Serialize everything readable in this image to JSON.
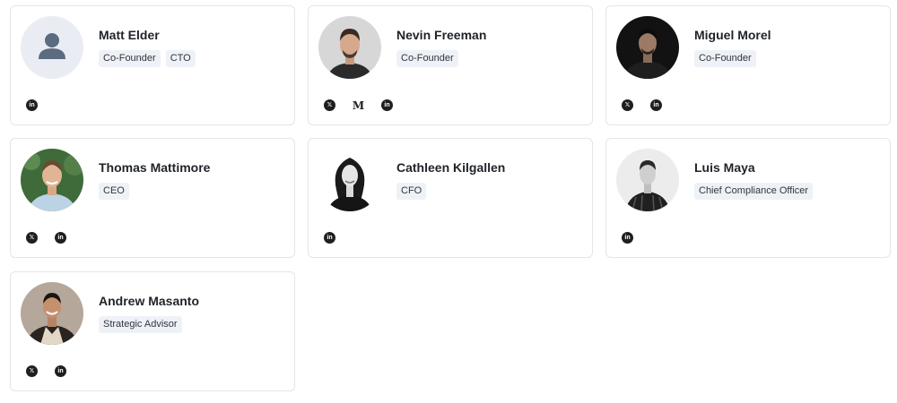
{
  "team": [
    {
      "name": "Matt Elder",
      "tags": [
        "Co-Founder",
        "CTO"
      ],
      "avatar": "placeholder-person-icon",
      "socials": [
        {
          "icon": "linkedin-icon",
          "glyph": "in"
        }
      ]
    },
    {
      "name": "Nevin Freeman",
      "tags": [
        "Co-Founder"
      ],
      "avatar": "photo",
      "socials": [
        {
          "icon": "x-icon",
          "glyph": "𝕏"
        },
        {
          "icon": "medium-icon",
          "glyph": "M"
        },
        {
          "icon": "linkedin-icon",
          "glyph": "in"
        }
      ]
    },
    {
      "name": "Miguel Morel",
      "tags": [
        "Co-Founder"
      ],
      "avatar": "photo",
      "socials": [
        {
          "icon": "x-icon",
          "glyph": "𝕏"
        },
        {
          "icon": "linkedin-icon",
          "glyph": "in"
        }
      ]
    },
    {
      "name": "Thomas Mattimore",
      "tags": [
        "CEO"
      ],
      "avatar": "photo",
      "socials": [
        {
          "icon": "x-icon",
          "glyph": "𝕏"
        },
        {
          "icon": "linkedin-icon",
          "glyph": "in"
        }
      ]
    },
    {
      "name": "Cathleen Kilgallen",
      "tags": [
        "CFO"
      ],
      "avatar": "photo",
      "socials": [
        {
          "icon": "linkedin-icon",
          "glyph": "in"
        }
      ]
    },
    {
      "name": "Luis Maya",
      "tags": [
        "Chief Compliance Officer"
      ],
      "avatar": "photo",
      "socials": [
        {
          "icon": "linkedin-icon",
          "glyph": "in"
        }
      ]
    },
    {
      "name": "Andrew Masanto",
      "tags": [
        "Strategic Advisor"
      ],
      "avatar": "photo",
      "socials": [
        {
          "icon": "x-icon",
          "glyph": "𝕏"
        },
        {
          "icon": "linkedin-icon",
          "glyph": "in"
        }
      ]
    }
  ],
  "colors": {
    "card_border": "#e3e5e8",
    "tag_bg": "#eef2f7",
    "name_text": "#1f2328",
    "social_icon": "#1f1f1f"
  }
}
